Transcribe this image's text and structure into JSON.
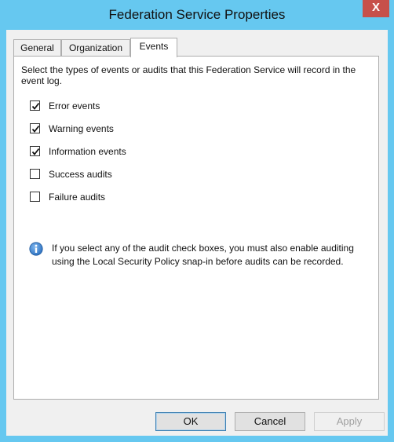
{
  "window": {
    "title": "Federation Service Properties",
    "close_glyph": "X"
  },
  "tabs": [
    {
      "label": "General",
      "active": false
    },
    {
      "label": "Organization",
      "active": false
    },
    {
      "label": "Events",
      "active": true
    }
  ],
  "events": {
    "intro": "Select the types of events or audits that this Federation Service will record in the event log.",
    "checkboxes": [
      {
        "label": "Error events",
        "checked": true
      },
      {
        "label": "Warning events",
        "checked": true
      },
      {
        "label": "Information events",
        "checked": true
      },
      {
        "label": "Success audits",
        "checked": false
      },
      {
        "label": "Failure audits",
        "checked": false
      }
    ],
    "info_icon": "info-icon",
    "info_text": "If you select any of the audit check boxes, you must also enable auditing using the Local Security Policy snap-in before audits can be recorded."
  },
  "buttons": {
    "ok": "OK",
    "cancel": "Cancel",
    "apply": "Apply"
  },
  "colors": {
    "title_bar": "#66c8f0",
    "close_button": "#c7504a",
    "info_icon": "#2a6fbf"
  }
}
